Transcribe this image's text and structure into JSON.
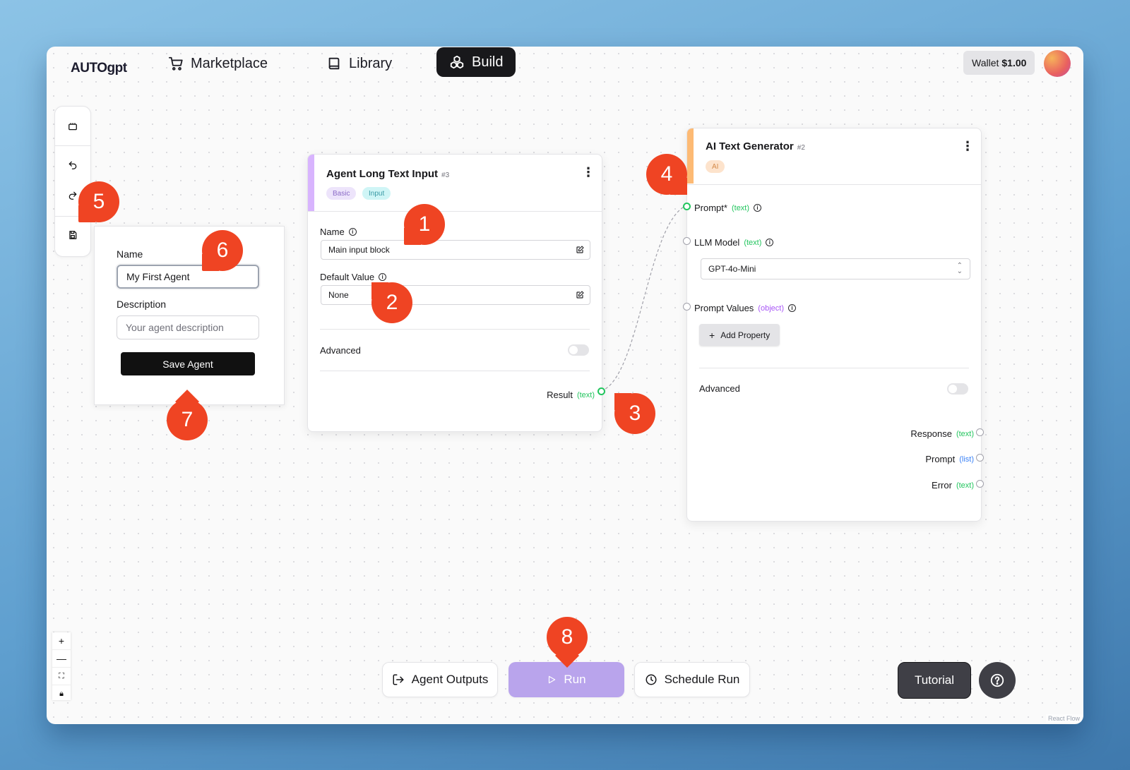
{
  "nav": {
    "logo": "AUTOgpt",
    "marketplace": "Marketplace",
    "library": "Library",
    "build": "Build",
    "wallet_label": "Wallet",
    "wallet_amount": "$1.00"
  },
  "save_panel": {
    "name_label": "Name",
    "name_value": "My First Agent",
    "description_label": "Description",
    "description_placeholder": "Your agent description",
    "save_button": "Save Agent"
  },
  "input_block": {
    "title": "Agent Long Text Input",
    "id": "#3",
    "badges": [
      "Basic",
      "Input"
    ],
    "name_label": "Name",
    "name_value": "Main input block",
    "default_label": "Default Value",
    "default_value": "None",
    "advanced_label": "Advanced",
    "output_label": "Result",
    "output_type": "(text)"
  },
  "ai_block": {
    "title": "AI Text Generator",
    "id": "#2",
    "badge": "AI",
    "prompt_label": "Prompt*",
    "prompt_type": "(text)",
    "llm_label": "LLM Model",
    "llm_type": "(text)",
    "llm_value": "GPT-4o-Mini",
    "prompt_values_label": "Prompt Values",
    "prompt_values_type": "(object)",
    "add_property": "Add Property",
    "advanced_label": "Advanced",
    "outputs": [
      {
        "label": "Response",
        "type": "(text)"
      },
      {
        "label": "Prompt",
        "type": "(list)"
      },
      {
        "label": "Error",
        "type": "(text)"
      }
    ]
  },
  "bottom": {
    "agent_outputs": "Agent Outputs",
    "run": "Run",
    "schedule_run": "Schedule Run",
    "tutorial": "Tutorial"
  },
  "react_flow_credit": "React Flow",
  "markers": [
    "1",
    "2",
    "3",
    "4",
    "5",
    "6",
    "7",
    "8"
  ],
  "colors": {
    "accent_marker": "#ef4423",
    "input_accent": "#d8b4fe",
    "ai_accent": "#fdba74",
    "run_button": "#b9a4ec",
    "type_text": "#22c55e",
    "type_object": "#a855f7",
    "type_list": "#3b82f6"
  }
}
